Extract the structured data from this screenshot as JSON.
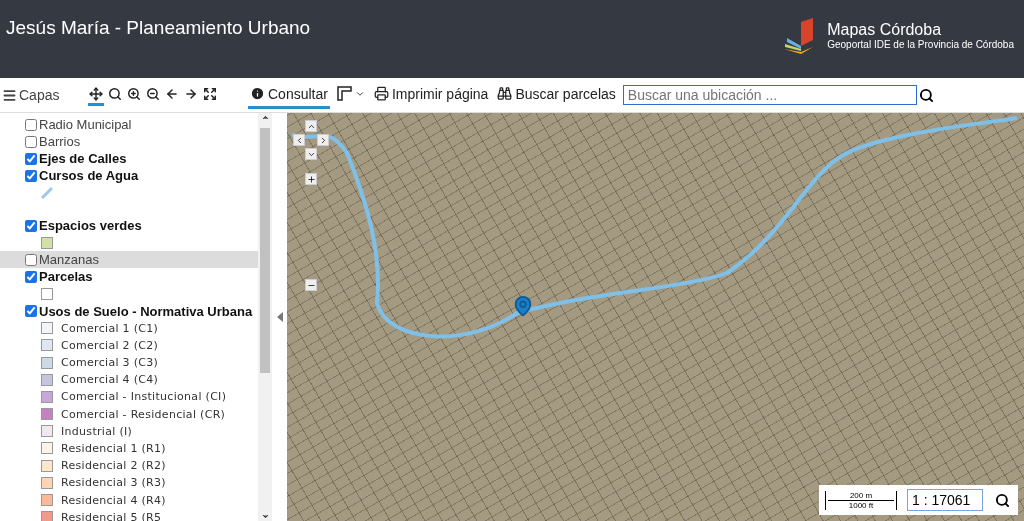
{
  "header": {
    "title": "Jesús María - Planeamiento Urbano",
    "logo_title": "Mapas Córdoba",
    "logo_subtitle": "Geoportal IDE de la Provincia de Córdoba"
  },
  "toolbar": {
    "layers_label": "Capas",
    "tools": [
      {
        "kind": "pan",
        "selected": true
      },
      {
        "kind": "find",
        "selected": false
      },
      {
        "kind": "zoom-in",
        "selected": false
      },
      {
        "kind": "zoom-out",
        "selected": false
      },
      {
        "kind": "back",
        "selected": false
      },
      {
        "kind": "forward",
        "selected": false
      },
      {
        "kind": "full-extent",
        "selected": false
      }
    ],
    "actions": [
      {
        "kind": "info",
        "label": "Consultar",
        "selected": true
      },
      {
        "kind": "measure",
        "selected": false
      },
      {
        "kind": "print",
        "label": "Imprimir página",
        "selected": false
      },
      {
        "kind": "binoculars",
        "label": "Buscar parcelas",
        "selected": false
      }
    ],
    "search": {
      "placeholder": "Buscar una ubicación ..."
    }
  },
  "layers": [
    {
      "label": "Radio Municipal",
      "checked": false,
      "highlighted": false
    },
    {
      "label": "Barrios",
      "checked": false,
      "highlighted": false
    },
    {
      "label": "Ejes de Calles",
      "checked": true,
      "highlighted": false
    },
    {
      "label": "Cursos de Agua",
      "checked": true,
      "highlighted": false,
      "legend": [
        {
          "kind": "line",
          "color": "#9cc8ee"
        }
      ]
    },
    {
      "label": "Espacios verdes",
      "checked": true,
      "highlighted": false,
      "legend": [
        {
          "kind": "fill",
          "color": "#d3e0a6"
        }
      ]
    },
    {
      "label": "Manzanas",
      "checked": false,
      "highlighted": true
    },
    {
      "label": "Parcelas",
      "checked": true,
      "highlighted": false,
      "legend": [
        {
          "kind": "fill",
          "color": "#ffffff"
        }
      ]
    },
    {
      "label": "Usos de Suelo - Normativa Urbana",
      "checked": true,
      "highlighted": false,
      "legend": [
        {
          "kind": "fill",
          "color": "#f2f6fa",
          "label": "Comercial 1 (C1)"
        },
        {
          "kind": "fill",
          "color": "#dfe7f0",
          "label": "Comercial 2 (C2)"
        },
        {
          "kind": "fill",
          "color": "#ccdae8",
          "label": "Comercial 3 (C3)"
        },
        {
          "kind": "fill",
          "color": "#c5c6de",
          "label": "Comercial 4 (C4)"
        },
        {
          "kind": "fill",
          "color": "#c7a9d8",
          "label": "Comercial - Institucional (CI)"
        },
        {
          "kind": "fill",
          "color": "#c283c0",
          "label": "Comercial - Residencial (CR)"
        },
        {
          "kind": "fill",
          "color": "#f1e7f1",
          "label": "Industrial (I)"
        },
        {
          "kind": "fill",
          "color": "#fdf4e9",
          "label": "Residencial 1 (R1)"
        },
        {
          "kind": "fill",
          "color": "#fde6cc",
          "label": "Residencial 2 (R2)"
        },
        {
          "kind": "fill",
          "color": "#fdd5b5",
          "label": "Residencial 3 (R3)"
        },
        {
          "kind": "fill",
          "color": "#fbb99c",
          "label": "Residencial 4 (R4)"
        },
        {
          "kind": "fill",
          "color": "#f09a8c",
          "label": "Residencial 5 (R5"
        }
      ]
    }
  ],
  "map": {
    "scale_metric": "200 m",
    "scale_imperial": "1000 ft",
    "scale_value": "1 : 17061"
  }
}
